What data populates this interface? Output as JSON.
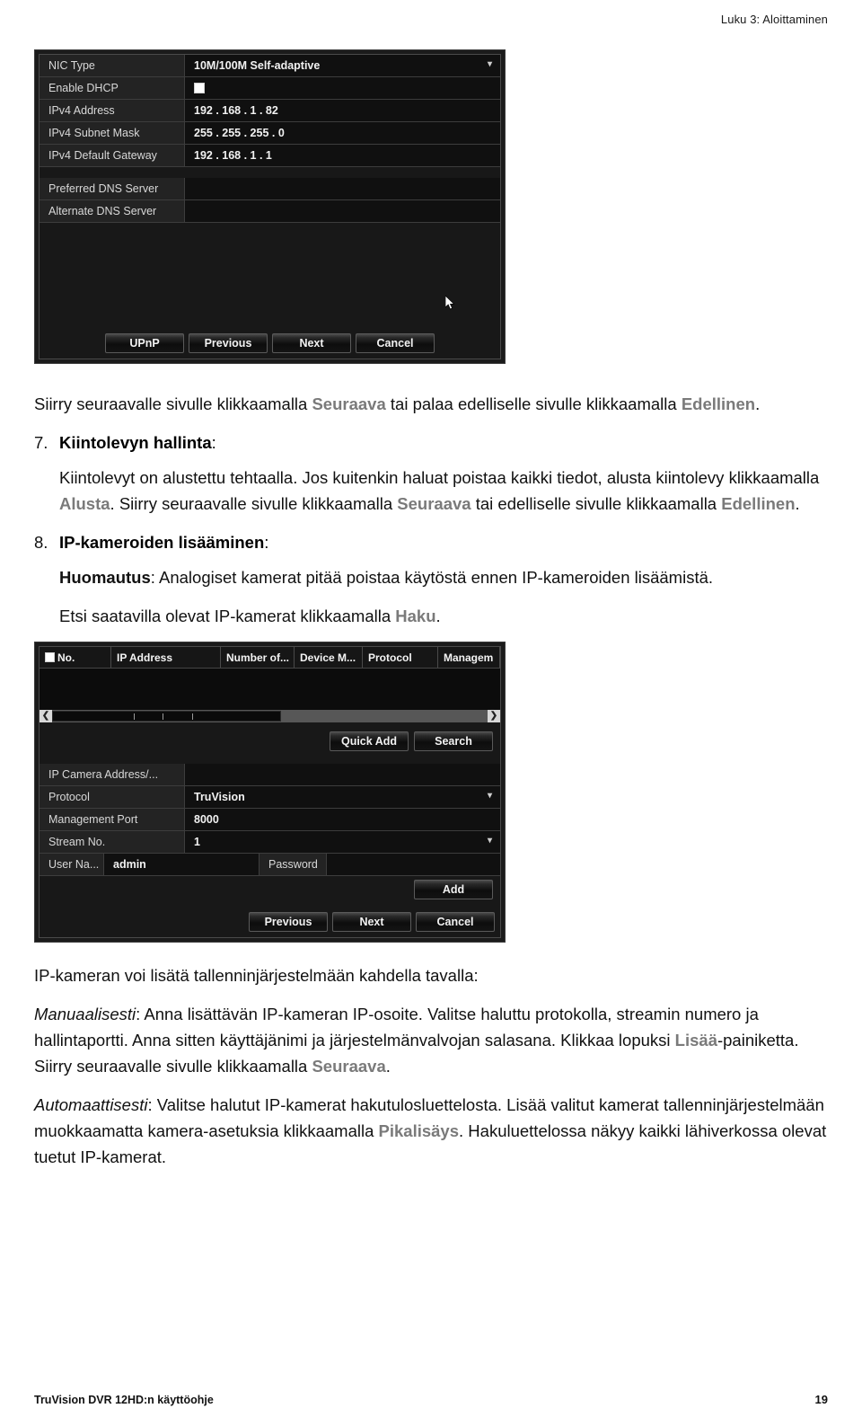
{
  "header": {
    "chapter": "Luku 3: Aloittaminen"
  },
  "footer": {
    "manual_title": "TruVision DVR 12HD:n käyttöohje",
    "page_number": "19"
  },
  "screenshot_network": {
    "rows": [
      {
        "label": "NIC Type",
        "value": "10M/100M Self-adaptive",
        "type": "dropdown"
      },
      {
        "label": "Enable DHCP",
        "value": "",
        "type": "checkbox"
      },
      {
        "label": "IPv4 Address",
        "value": "192 . 168 . 1      . 82",
        "type": "text"
      },
      {
        "label": "IPv4 Subnet Mask",
        "value": "255 . 255 . 255 . 0",
        "type": "text"
      },
      {
        "label": "IPv4 Default Gateway",
        "value": "192 . 168 . 1      . 1",
        "type": "text"
      },
      {
        "label": "Preferred DNS Server",
        "value": "",
        "type": "text"
      },
      {
        "label": "Alternate DNS Server",
        "value": "",
        "type": "text"
      }
    ],
    "buttons": [
      "UPnP",
      "Previous",
      "Next",
      "Cancel"
    ]
  },
  "screenshot_ipcam": {
    "table_headers": [
      "No.",
      "IP Address",
      "Number of...",
      "Device M...",
      "Protocol",
      "Managem"
    ],
    "action_buttons": [
      "Quick Add",
      "Search"
    ],
    "rows": [
      {
        "label": "IP Camera Address/...",
        "value": "",
        "type": "text"
      },
      {
        "label": "Protocol",
        "value": "TruVision",
        "type": "dropdown"
      },
      {
        "label": "Management Port",
        "value": "8000",
        "type": "text"
      },
      {
        "label": "Stream No.",
        "value": "1",
        "type": "dropdown"
      }
    ],
    "user_row": {
      "label": "User Na...",
      "value": "admin",
      "password_label": "Password",
      "password_value": ""
    },
    "add_button": "Add",
    "buttons": [
      "Previous",
      "Next",
      "Cancel"
    ]
  },
  "body": {
    "p1_a": "Siirry seuraavalle sivulle klikkaamalla ",
    "p1_hl1": "Seuraava",
    "p1_b": " tai palaa edelliselle sivulle klikkaamalla ",
    "p1_hl2": "Edellinen",
    "p1_c": ".",
    "step7_num": "7.",
    "step7_title_bold": "Kiintolevyn hallinta",
    "step7_title_tail": ":",
    "step7_p_a": "Kiintolevyt on alustettu tehtaalla. Jos kuitenkin haluat poistaa kaikki tiedot, alusta kiintolevy klikkaamalla ",
    "step7_p_hl1": "Alusta",
    "step7_p_b": ". Siirry seuraavalle sivulle klikkaamalla ",
    "step7_p_hl2": "Seuraava",
    "step7_p_c": " tai edelliselle sivulle klikkaamalla ",
    "step7_p_hl3": "Edellinen",
    "step7_p_d": ".",
    "step8_num": "8.",
    "step8_title_bold": "IP-kameroiden lisääminen",
    "step8_title_tail": ":",
    "step8_note_bold": "Huomautus",
    "step8_note_text": ": Analogiset kamerat pitää poistaa käytöstä ennen IP-kameroiden lisäämistä.",
    "step8_search_a": "Etsi saatavilla olevat IP-kamerat klikkaamalla ",
    "step8_search_hl": "Haku",
    "step8_search_b": ".",
    "p2": "IP-kameran voi lisätä tallenninjärjestelmään kahdella tavalla:",
    "p3_ital": "Manuaalisesti",
    "p3_a": ": Anna lisättävän IP-kameran IP-osoite. Valitse haluttu protokolla, streamin numero ja hallintaportti. Anna sitten käyttäjänimi ja järjestelmänvalvojan salasana. Klikkaa lopuksi ",
    "p3_hl1": "Lisää",
    "p3_b": "-painiketta. Siirry seuraavalle sivulle klikkaamalla ",
    "p3_hl2": "Seuraava",
    "p3_c": ".",
    "p4_ital": "Automaattisesti",
    "p4_a": ": Valitse halutut IP-kamerat hakutulosluettelosta. Lisää valitut kamerat tallenninjärjestelmään muokkaamatta kamera-asetuksia klikkaamalla ",
    "p4_hl1": "Pikalisäys",
    "p4_b": ". Hakuluettelossa näkyy kaikki lähiverkossa olevat tuetut IP-kamerat."
  }
}
